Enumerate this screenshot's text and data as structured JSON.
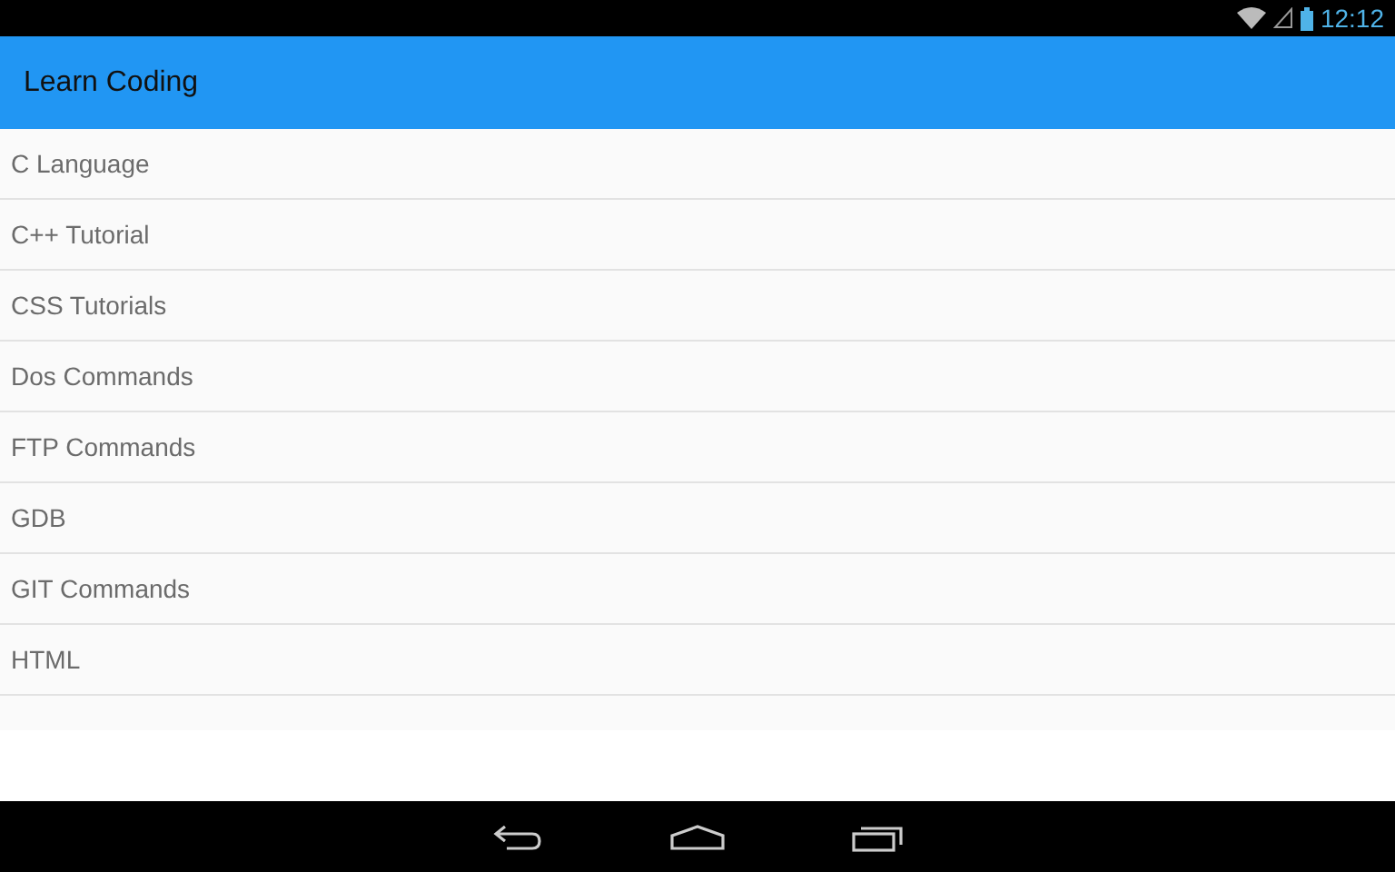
{
  "status_bar": {
    "time": "12:12"
  },
  "app_bar": {
    "title": "Learn Coding"
  },
  "list": [
    {
      "label": "C Language"
    },
    {
      "label": "C++ Tutorial"
    },
    {
      "label": "CSS Tutorials"
    },
    {
      "label": "Dos Commands"
    },
    {
      "label": "FTP Commands"
    },
    {
      "label": "GDB"
    },
    {
      "label": "GIT Commands"
    },
    {
      "label": "HTML"
    }
  ]
}
